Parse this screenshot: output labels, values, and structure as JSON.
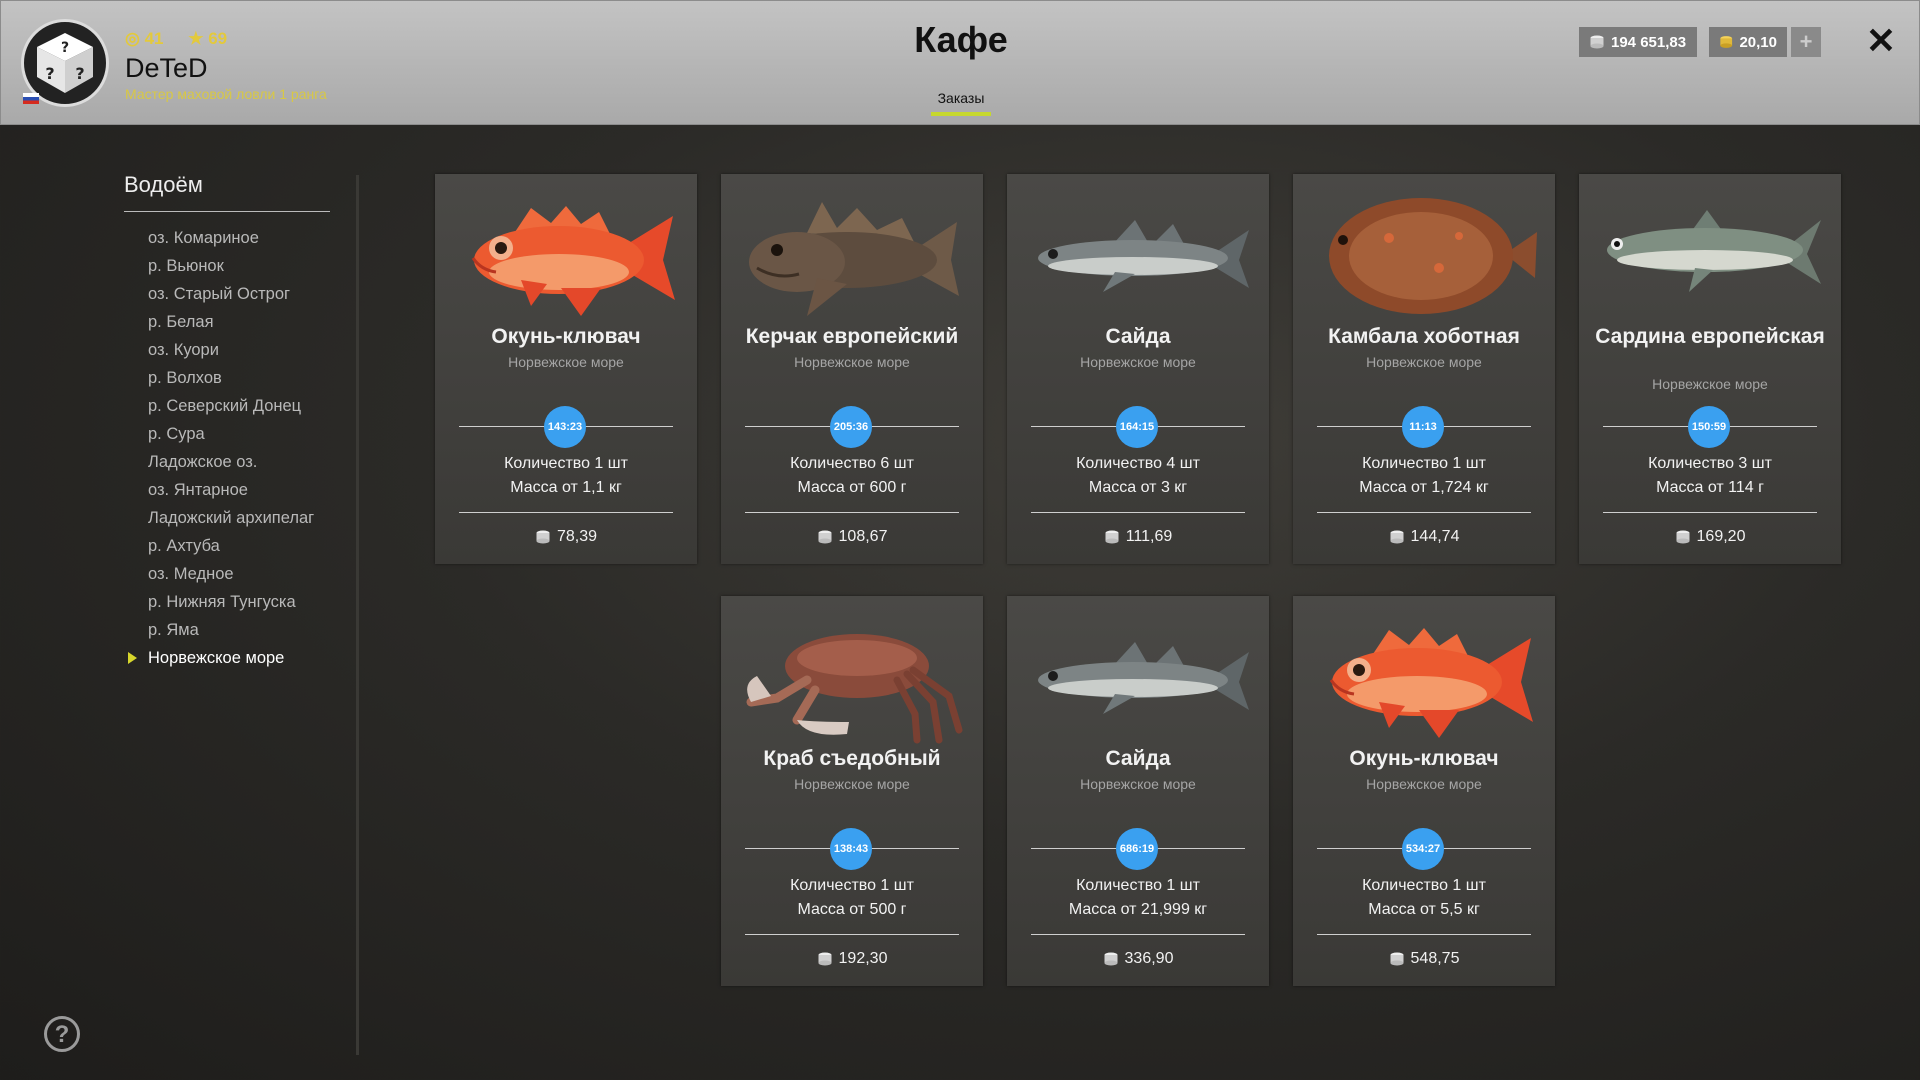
{
  "header": {
    "title": "Кафе",
    "tab_label": "Заказы",
    "player": {
      "level": "41",
      "stars": "69",
      "name": "DeTeD",
      "rank": "Мастер маховой ловли 1 ранга"
    },
    "currency": {
      "silver": "194 651,83",
      "gold": "20,10",
      "add_label": "+"
    },
    "close_label": "✕"
  },
  "sidebar": {
    "title": "Водоём",
    "items": [
      {
        "label": "оз. Комариное"
      },
      {
        "label": "р. Вьюнок"
      },
      {
        "label": "оз. Старый Острог"
      },
      {
        "label": "р. Белая"
      },
      {
        "label": "оз. Куори"
      },
      {
        "label": "р. Волхов"
      },
      {
        "label": "р. Северский Донец"
      },
      {
        "label": "р. Сура"
      },
      {
        "label": "Ладожское оз."
      },
      {
        "label": "оз. Янтарное"
      },
      {
        "label": "Ладожский архипелаг"
      },
      {
        "label": "р. Ахтуба"
      },
      {
        "label": "оз. Медное"
      },
      {
        "label": "р. Нижняя Тунгуска"
      },
      {
        "label": "р. Яма"
      },
      {
        "label": "Норвежское море"
      }
    ],
    "active_item": "Норвежское море",
    "help_label": "?"
  },
  "orders": [
    {
      "fish": "Окунь-клювач",
      "location": "Норвежское море",
      "timer": "143:23",
      "quantity": "Количество 1 шт",
      "mass": "Масса от 1,1 кг",
      "price": "78,39",
      "icon": "redfish-image"
    },
    {
      "fish": "Керчак европейский",
      "location": "Норвежское море",
      "timer": "205:36",
      "quantity": "Количество 6 шт",
      "mass": "Масса от 600 г",
      "price": "108,67",
      "icon": "sculpin-image"
    },
    {
      "fish": "Сайда",
      "location": "Норвежское море",
      "timer": "164:15",
      "quantity": "Количество 4 шт",
      "mass": "Масса от 3 кг",
      "price": "111,69",
      "icon": "pollock-image"
    },
    {
      "fish": "Камбала хоботная",
      "location": "Норвежское море",
      "timer": "11:13",
      "quantity": "Количество 1 шт",
      "mass": "Масса от 1,724 кг",
      "price": "144,74",
      "icon": "flounder-image"
    },
    {
      "fish": "Сардина европейская",
      "location": "Норвежское море",
      "timer": "150:59",
      "quantity": "Количество 3 шт",
      "mass": "Масса от 114 г",
      "price": "169,20",
      "icon": "sardine-image"
    },
    {
      "fish": "Краб съедобный",
      "location": "Норвежское море",
      "timer": "138:43",
      "quantity": "Количество 1 шт",
      "mass": "Масса от 500 г",
      "price": "192,30",
      "icon": "crab-image"
    },
    {
      "fish": "Сайда",
      "location": "Норвежское море",
      "timer": "686:19",
      "quantity": "Количество 1 шт",
      "mass": "Масса от 21,999 кг",
      "price": "336,90",
      "icon": "pollock-image"
    },
    {
      "fish": "Окунь-клювач",
      "location": "Норвежское море",
      "timer": "534:27",
      "quantity": "Количество 1 шт",
      "mass": "Масса от 5,5 кг",
      "price": "548,75",
      "icon": "redfish-image"
    }
  ],
  "colors": {
    "accent": "#c6d82e",
    "timer": "#3aa0f0",
    "rank_text": "#d8c845"
  }
}
